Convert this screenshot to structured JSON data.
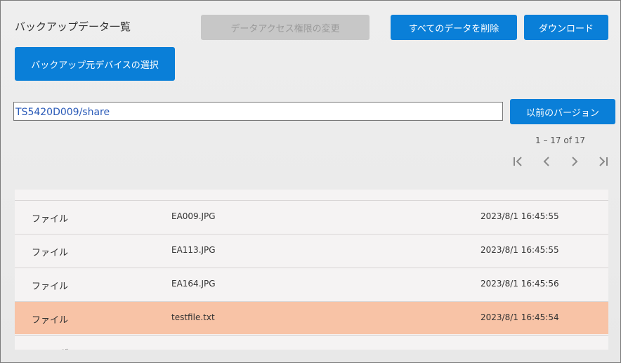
{
  "header": {
    "title": "バックアップデータ一覧",
    "access_button": "データアクセス権限の変更",
    "delete_all_button": "すべてのデータを削除",
    "download_button": "ダウンロード",
    "select_device_button": "バックアップ元デバイスの選択"
  },
  "path": {
    "value": "TS5420D009/share",
    "previous_version_button": "以前のバージョン"
  },
  "pagination": {
    "range": "1 – 17 of 17",
    "first_icon": "first-page-icon",
    "prev_icon": "chevron-left-icon",
    "next_icon": "chevron-right-icon",
    "last_icon": "last-page-icon"
  },
  "rows": [
    {
      "type": "ファイル",
      "name": "EA009.JPG",
      "date": "2023/8/1 16:45:55",
      "selected": false
    },
    {
      "type": "ファイル",
      "name": "EA113.JPG",
      "date": "2023/8/1 16:45:55",
      "selected": false
    },
    {
      "type": "ファイル",
      "name": "EA164.JPG",
      "date": "2023/8/1 16:45:56",
      "selected": false
    },
    {
      "type": "ファイル",
      "name": "testfile.txt",
      "date": "2023/8/1 16:45:54",
      "selected": true
    },
    {
      "type": "フォルダ",
      "name": "",
      "date": "",
      "selected": false
    }
  ],
  "colors": {
    "primary": "#0a7fd8",
    "disabled": "#c7c7c7",
    "selected_row": "#f8c3a6",
    "link_text": "#2b5bb8"
  }
}
